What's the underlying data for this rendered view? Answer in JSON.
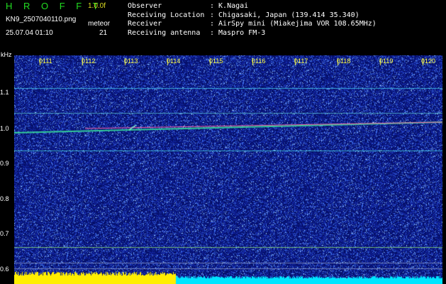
{
  "header": {
    "app_title": "H R O F F T",
    "version": "1.0.0f",
    "filename": "KN9_2507040110.png",
    "mode": "meteor",
    "datetime": "25.07.04 01:10",
    "count": "21"
  },
  "info": [
    {
      "key": "Observer",
      "value": ": K.Nagai"
    },
    {
      "key": "Receiving Location",
      "value": ": Chigasaki, Japan (139.414 35.340)"
    },
    {
      "key": "Receiver",
      "value": ": AirSpy mini (Miakejima VOR 108.65MHz)"
    },
    {
      "key": "Receiving antenna",
      "value": ": Maspro FM-3"
    }
  ],
  "y_axis": {
    "unit": "kHz",
    "ticks": [
      "1.1",
      "1.0",
      "0.9",
      "0.8",
      "0.7",
      "0.6"
    ]
  },
  "x_axis": {
    "ticks": [
      "0111",
      "0112",
      "0113",
      "0114",
      "0115",
      "0116",
      "0117",
      "0118",
      "0119",
      "0120"
    ]
  },
  "colors": {
    "background_noise": "#0a1a8a",
    "signal_line": "#44ddaa",
    "meteor_trace": "#ff66aa",
    "bottom_bar_left": "#ffee00",
    "bottom_bar_right": "#00e5ff"
  }
}
